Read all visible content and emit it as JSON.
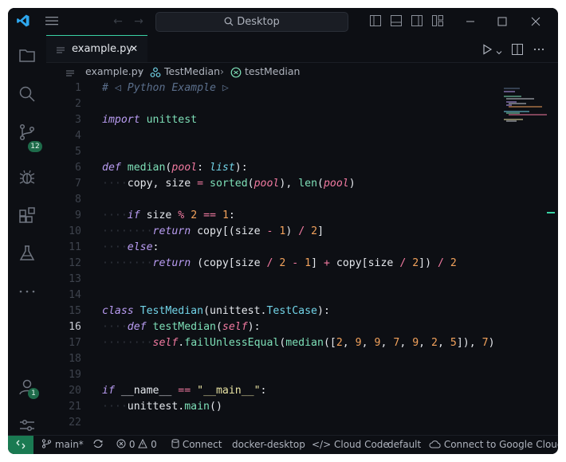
{
  "titlebar": {
    "search_label": "Desktop"
  },
  "activity": {
    "source_control_badge": "12",
    "accounts_badge": "1"
  },
  "tabs": [
    {
      "label": "example.py",
      "close": "✕"
    }
  ],
  "breadcrumb": {
    "file": "example.py",
    "class": "TestMedian",
    "method": "testMedian"
  },
  "editor": {
    "current_line": 16,
    "line_numbers": [
      "1",
      "2",
      "3",
      "4",
      "5",
      "6",
      "7",
      "8",
      "9",
      "10",
      "11",
      "12",
      "13",
      "14",
      "15",
      "16",
      "17",
      "18",
      "19",
      "20",
      "21",
      "22"
    ],
    "lines": [
      "# ◁ Python Example ▷",
      "",
      "import unittest",
      "",
      "",
      "def median(pool: list):",
      "    copy, size = sorted(pool), len(pool)",
      "",
      "    if size % 2 == 1:",
      "        return copy[(size - 1) / 2]",
      "    else:",
      "        return (copy[size / 2 - 1] + copy[size / 2]) / 2",
      "",
      "",
      "class TestMedian(unittest.TestCase):",
      "    def testMedian(self):",
      "        self.failUnlessEqual(median([2, 9, 9, 7, 9, 2, 5]), 7)",
      "",
      "",
      "if __name__ == \"__main__\":",
      "    unittest.main()",
      ""
    ]
  },
  "status": {
    "branch": "main*",
    "errors": "0",
    "warnings": "0",
    "connect": "Connect",
    "docker": "docker-desktop",
    "cloud_code": "Cloud Code",
    "default": "default",
    "google_cloud": "Connect to Google Cloud"
  },
  "colors": {
    "accent": "#39d2a4",
    "background": "#0d0f14",
    "remote": "#1a7a52"
  }
}
